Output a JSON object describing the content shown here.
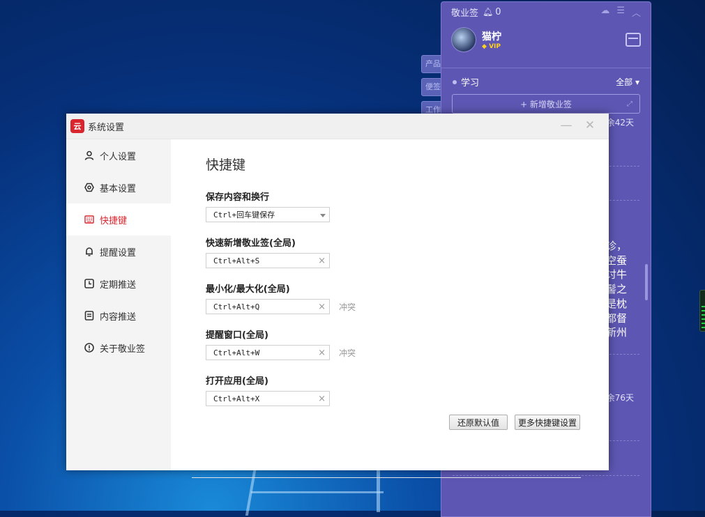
{
  "note_panel": {
    "app_name": "敬业签",
    "reminder_count": "0",
    "user_name": "猫柠",
    "vip_label": "VIP",
    "category": "学习",
    "filter": "全部",
    "new_note_label": "+ 新增敬业签",
    "days_left_1": "余42天",
    "days_left_2": "余76天",
    "note_text_lines": [
      "诊，",
      "空蚕",
      "讨牛",
      "髻之",
      "是枕",
      "都督",
      "新州"
    ],
    "side_tabs": [
      "产品",
      "便签",
      "工作"
    ]
  },
  "dialog": {
    "title": "系统设置",
    "app_icon_glyph": "云",
    "nav": [
      {
        "label": "个人设置",
        "icon": "person-icon"
      },
      {
        "label": "基本设置",
        "icon": "hexagon-settings-icon"
      },
      {
        "label": "快捷键",
        "icon": "keyboard-icon"
      },
      {
        "label": "提醒设置",
        "icon": "bell-icon"
      },
      {
        "label": "定期推送",
        "icon": "clock-icon"
      },
      {
        "label": "内容推送",
        "icon": "document-icon"
      },
      {
        "label": "关于敬业签",
        "icon": "info-icon"
      }
    ],
    "active_nav": "快捷键",
    "heading": "快捷键",
    "shortcuts": [
      {
        "label": "保存内容和换行",
        "value": "Ctrl+回车键保存",
        "type": "select",
        "conflict": ""
      },
      {
        "label": "快速新增敬业签(全局)",
        "value": "Ctrl+Alt+S",
        "type": "input",
        "conflict": ""
      },
      {
        "label": "最小化/最大化(全局)",
        "value": "Ctrl+Alt+Q",
        "type": "input",
        "conflict": "冲突"
      },
      {
        "label": "提醒窗口(全局)",
        "value": "Ctrl+Alt+W",
        "type": "input",
        "conflict": "冲突"
      },
      {
        "label": "打开应用(全局)",
        "value": "Ctrl+Alt+X",
        "type": "input",
        "conflict": ""
      }
    ],
    "restore_default_label": "还原默认值",
    "more_shortcuts_label": "更多快捷键设置"
  }
}
